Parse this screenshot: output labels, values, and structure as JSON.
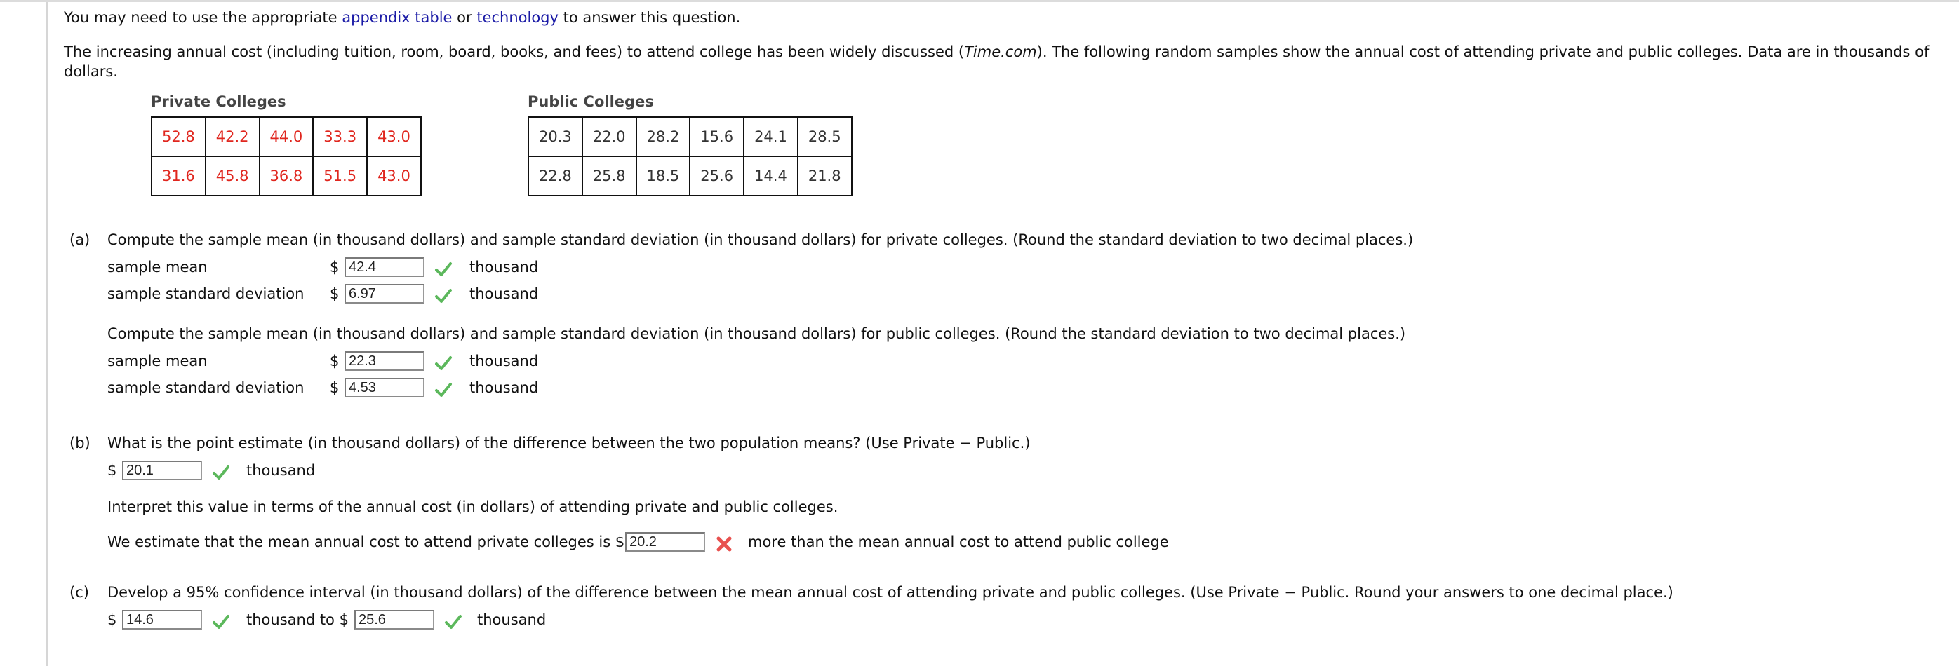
{
  "intro": {
    "line1_prefix": "You may need to use the appropriate ",
    "link_appendix": "appendix table",
    "line1_mid": " or ",
    "link_technology": "technology",
    "line1_suffix": " to answer this question.",
    "para_part1": "The increasing annual cost (including tuition, room, board, books, and fees) to attend college has been widely discussed (",
    "para_source": "Time.com",
    "para_part2": "). The following random samples show the annual cost of attending private and public colleges. Data are in thousands of dollars."
  },
  "tables": {
    "private": {
      "title": "Private Colleges",
      "rows": [
        [
          "52.8",
          "42.2",
          "44.0",
          "33.3",
          "43.0"
        ],
        [
          "31.6",
          "45.8",
          "36.8",
          "51.5",
          "43.0"
        ]
      ]
    },
    "public": {
      "title": "Public Colleges",
      "rows": [
        [
          "20.3",
          "22.0",
          "28.2",
          "15.6",
          "24.1",
          "28.5"
        ],
        [
          "22.8",
          "25.8",
          "18.5",
          "25.6",
          "14.4",
          "21.8"
        ]
      ]
    }
  },
  "part_a": {
    "letter": "(a)",
    "private_question": "Compute the sample mean (in thousand dollars) and sample standard deviation (in thousand dollars) for private colleges. (Round the standard deviation to two decimal places.)",
    "public_question": "Compute the sample mean (in thousand dollars) and sample standard deviation (in thousand dollars) for public colleges. (Round the standard deviation to two decimal places.)",
    "mean_label": "sample mean",
    "sd_label": "sample standard deviation",
    "currency": "$",
    "unit": "thousand",
    "private_mean": "42.4",
    "private_mean_status": "correct",
    "private_sd": "6.97",
    "private_sd_status": "correct",
    "public_mean": "22.3",
    "public_mean_status": "correct",
    "public_sd": "4.53",
    "public_sd_status": "correct"
  },
  "part_b": {
    "letter": "(b)",
    "question": "What is the point estimate (in thousand dollars) of the difference between the two population means? (Use Private − Public.)",
    "currency": "$",
    "point_estimate": "20.1",
    "point_estimate_status": "correct",
    "unit": "thousand",
    "interpret_prompt": "Interpret this value in terms of the annual cost (in dollars) of attending private and public colleges.",
    "sentence_prefix": "We estimate that the mean annual cost to attend private colleges is $",
    "interpret_value": "20.2",
    "interpret_status": "incorrect",
    "sentence_suffix": "more than the mean annual cost to attend public college"
  },
  "part_c": {
    "letter": "(c)",
    "question": "Develop a 95% confidence interval (in thousand dollars) of the difference between the mean annual cost of attending private and public colleges. (Use Private − Public. Round your answers to one decimal place.)",
    "currency": "$",
    "lower": "14.6",
    "lower_status": "correct",
    "middle_text": "thousand to $",
    "upper": "25.6",
    "upper_status": "correct",
    "unit": "thousand"
  },
  "colors": {
    "link": "#1a1aa6",
    "private_values": "#e0261e",
    "correct_check": "#5cb85c",
    "incorrect_x": "#e8514f"
  }
}
